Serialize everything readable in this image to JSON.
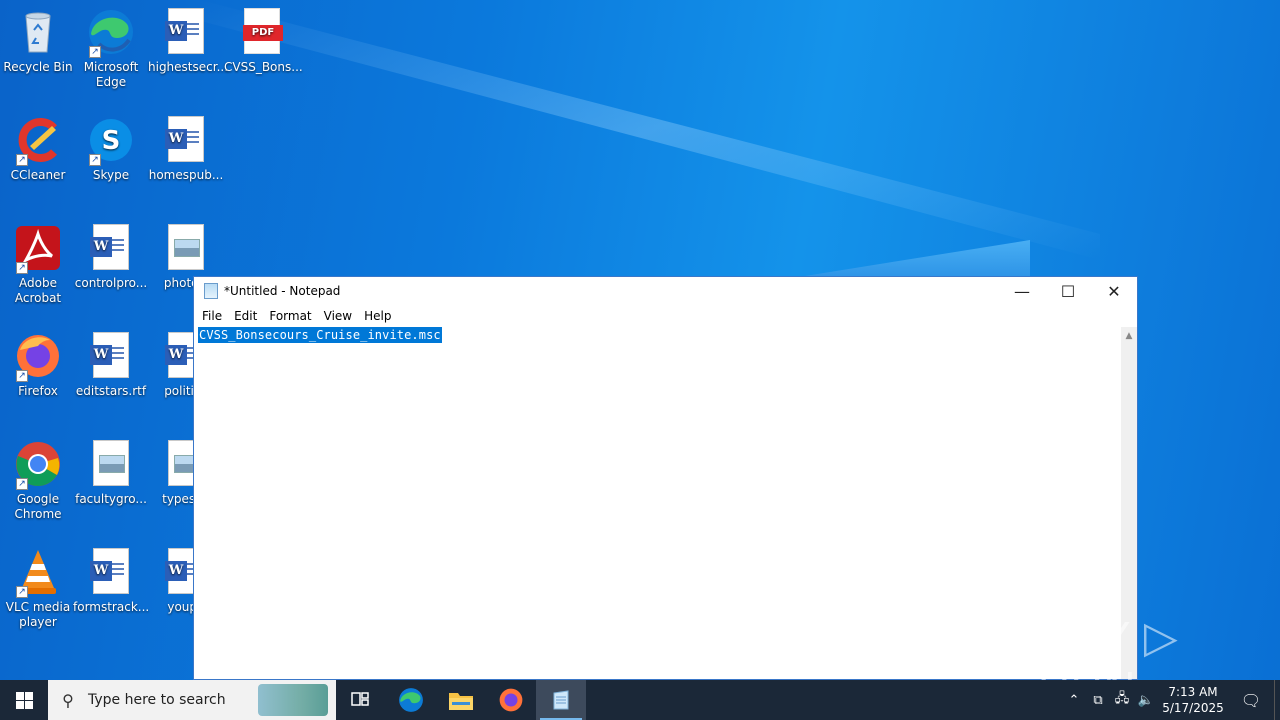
{
  "desktop": {
    "icons": [
      {
        "label": "Recycle Bin",
        "icon": "recycle-bin-icon"
      },
      {
        "label": "Microsoft Edge",
        "icon": "edge-icon"
      },
      {
        "label": "highestsecr...",
        "icon": "word-doc-icon"
      },
      {
        "label": "CVSS_Bons...",
        "icon": "pdf-icon"
      },
      {
        "label": "CCleaner",
        "icon": "ccleaner-icon"
      },
      {
        "label": "Skype",
        "icon": "skype-icon"
      },
      {
        "label": "homespub...",
        "icon": "word-doc-icon"
      },
      {
        "label": "Adobe Acrobat",
        "icon": "acrobat-icon"
      },
      {
        "label": "controlpro...",
        "icon": "word-doc-icon"
      },
      {
        "label": "photosl",
        "icon": "image-file-icon"
      },
      {
        "label": "Firefox",
        "icon": "firefox-icon"
      },
      {
        "label": "editstars.rtf",
        "icon": "word-doc-icon"
      },
      {
        "label": "politica",
        "icon": "word-doc-icon"
      },
      {
        "label": "Google Chrome",
        "icon": "chrome-icon"
      },
      {
        "label": "facultygro...",
        "icon": "image-file-icon"
      },
      {
        "label": "typesxb",
        "icon": "image-file-icon"
      },
      {
        "label": "VLC media player",
        "icon": "vlc-icon"
      },
      {
        "label": "formstrack...",
        "icon": "word-doc-icon"
      },
      {
        "label": "youpn",
        "icon": "word-doc-icon"
      }
    ]
  },
  "notepad": {
    "title": "*Untitled - Notepad",
    "menu": [
      "File",
      "Edit",
      "Format",
      "View",
      "Help"
    ],
    "content": "CVSS_Bonsecours_Cruise_invite.msc",
    "controls": {
      "minimize": "—",
      "maximize": "☐",
      "close": "✕"
    }
  },
  "watermark": "ANY ▷ RUN",
  "taskbar": {
    "search_placeholder": "Type here to search",
    "pinned": [
      "task-view-icon",
      "edge-icon",
      "file-explorer-icon",
      "firefox-icon",
      "notepad-icon"
    ],
    "clock_time": "7:13 AM",
    "clock_date": "5/17/2025"
  }
}
